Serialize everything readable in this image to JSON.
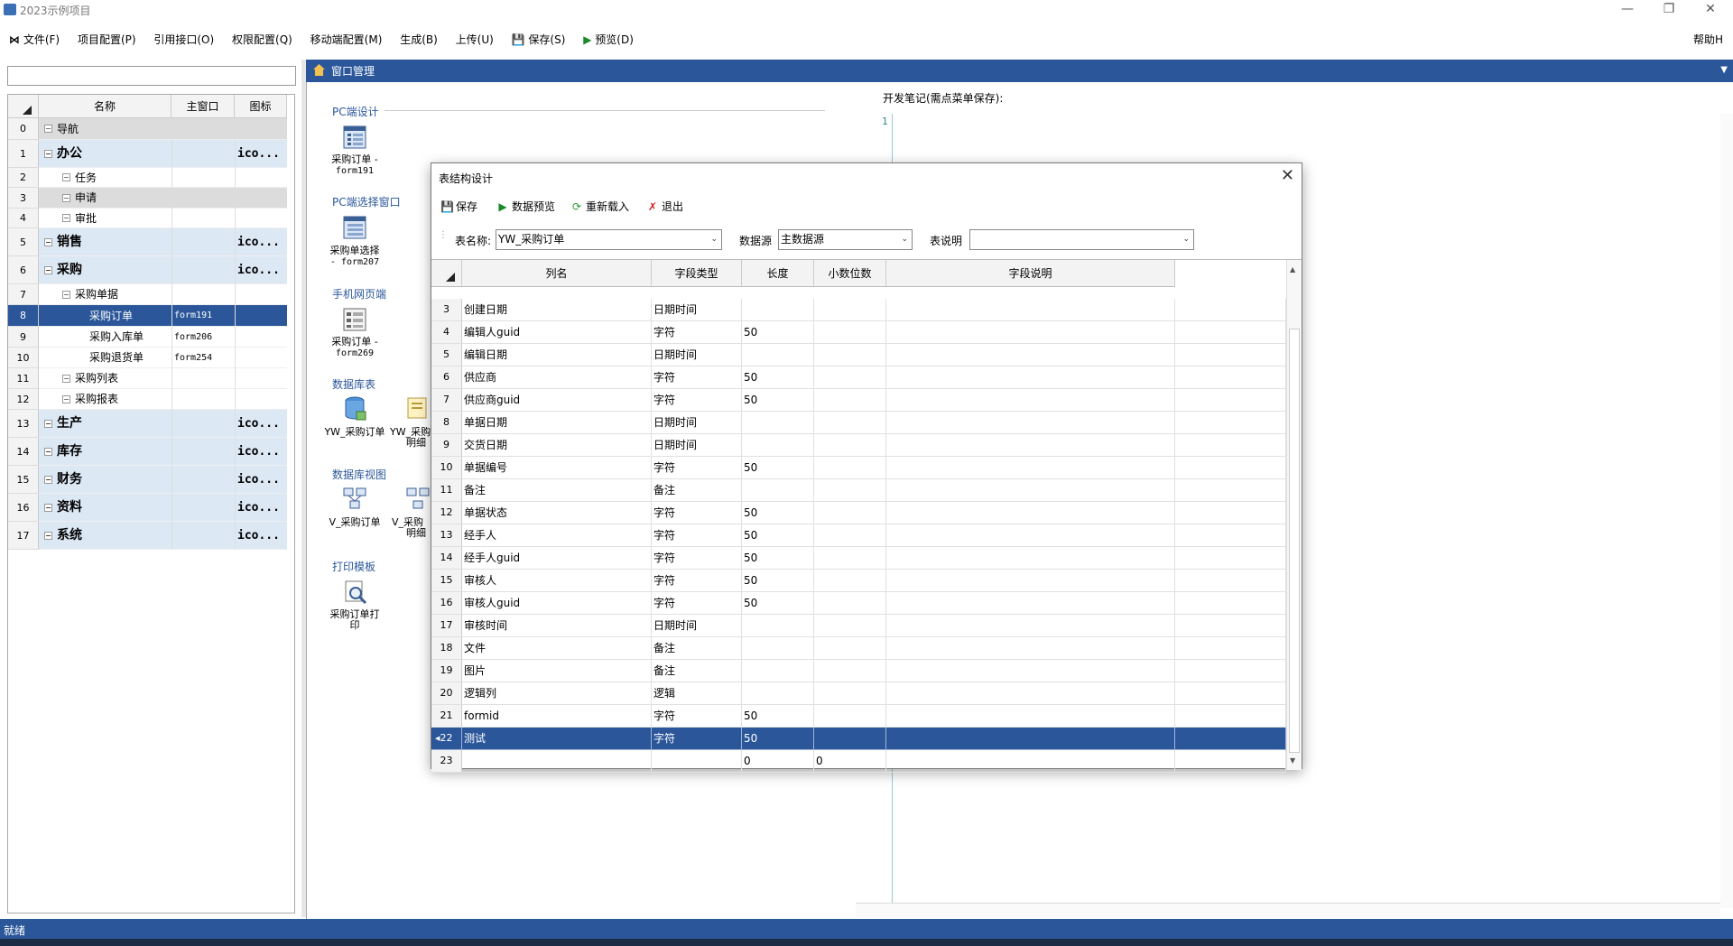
{
  "window": {
    "title": "2023示例项目"
  },
  "menu": [
    {
      "label": "文件(F)",
      "icon": "app-logo-icon"
    },
    {
      "label": "项目配置(P)"
    },
    {
      "label": "引用接口(O)"
    },
    {
      "label": "权限配置(Q)"
    },
    {
      "label": "移动端配置(M)"
    },
    {
      "label": "生成(B)"
    },
    {
      "label": "上传(U)"
    },
    {
      "label": "保存(S)",
      "icon": "floppy-icon"
    },
    {
      "label": "预览(D)",
      "icon": "play-icon"
    }
  ],
  "help": "帮助H",
  "tree": {
    "headers": [
      "名称",
      "主窗口",
      "图标"
    ],
    "rows": [
      {
        "n": "0",
        "name": "导航",
        "form": "",
        "icon": "",
        "level": 0,
        "style": "grey"
      },
      {
        "n": "1",
        "name": "办公",
        "form": "",
        "icon": "ico...",
        "level": 0,
        "style": "grp"
      },
      {
        "n": "2",
        "name": "任务",
        "form": "",
        "icon": "",
        "level": 1,
        "style": ""
      },
      {
        "n": "3",
        "name": "申请",
        "form": "",
        "icon": "",
        "level": 1,
        "style": "grey"
      },
      {
        "n": "4",
        "name": "审批",
        "form": "",
        "icon": "",
        "level": 1,
        "style": ""
      },
      {
        "n": "5",
        "name": "销售",
        "form": "",
        "icon": "ico...",
        "level": 0,
        "style": "grp"
      },
      {
        "n": "6",
        "name": "采购",
        "form": "",
        "icon": "ico...",
        "level": 0,
        "style": "grp"
      },
      {
        "n": "7",
        "name": "采购单据",
        "form": "",
        "icon": "",
        "level": 1,
        "style": ""
      },
      {
        "n": "8",
        "name": "采购订单",
        "form": "form191",
        "icon": "",
        "level": 2,
        "style": "sel"
      },
      {
        "n": "9",
        "name": "采购入库单",
        "form": "form206",
        "icon": "",
        "level": 2,
        "style": ""
      },
      {
        "n": "10",
        "name": "采购退货单",
        "form": "form254",
        "icon": "",
        "level": 2,
        "style": ""
      },
      {
        "n": "11",
        "name": "采购列表",
        "form": "",
        "icon": "",
        "level": 1,
        "style": ""
      },
      {
        "n": "12",
        "name": "采购报表",
        "form": "",
        "icon": "",
        "level": 1,
        "style": ""
      },
      {
        "n": "13",
        "name": "生产",
        "form": "",
        "icon": "ico...",
        "level": 0,
        "style": "grp"
      },
      {
        "n": "14",
        "name": "库存",
        "form": "",
        "icon": "ico...",
        "level": 0,
        "style": "grp"
      },
      {
        "n": "15",
        "name": "财务",
        "form": "",
        "icon": "ico...",
        "level": 0,
        "style": "grp"
      },
      {
        "n": "16",
        "name": "资料",
        "form": "",
        "icon": "ico...",
        "level": 0,
        "style": "grp"
      },
      {
        "n": "17",
        "name": "系统",
        "form": "",
        "icon": "ico...",
        "level": 0,
        "style": "grp"
      }
    ]
  },
  "panel": {
    "title": "窗口管理"
  },
  "sections": {
    "pc": {
      "title": "PC端设计",
      "items": [
        {
          "name": "采购订单 -",
          "sub": "form191"
        }
      ]
    },
    "pcsel": {
      "title": "PC端选择窗口",
      "items": [
        {
          "name": "采购单选择",
          "sub": "- form207"
        }
      ]
    },
    "mobile": {
      "title": "手机网页端",
      "items": [
        {
          "name": "采购订单 -",
          "sub": "form269"
        }
      ]
    },
    "db": {
      "title": "数据库表",
      "items": [
        {
          "name": "YW_采购订单",
          "sub": ""
        },
        {
          "name": "YW_采购",
          "sub": "明细"
        }
      ]
    },
    "dbview": {
      "title": "数据库视图",
      "items": [
        {
          "name": "V_采购订单",
          "sub": ""
        },
        {
          "name": "V_采购",
          "sub": "明细"
        }
      ]
    },
    "print": {
      "title": "打印模板",
      "items": [
        {
          "name": "采购订单打",
          "sub": "印"
        }
      ]
    }
  },
  "notes": {
    "label": "开发笔记(需点菜单保存):",
    "line": "1"
  },
  "status": "就绪",
  "dialog": {
    "title": "表结构设计",
    "toolbar": [
      {
        "label": "保存",
        "icon": "floppy-icon"
      },
      {
        "label": "数据预览",
        "icon": "play-icon"
      },
      {
        "label": "重新载入",
        "icon": "refresh-icon"
      },
      {
        "label": "退出",
        "icon": "close-icon"
      }
    ],
    "fields": {
      "table_label": "表名称:",
      "table_value": "YW_采购订单",
      "source_label": "数据源",
      "source_value": "主数据源",
      "desc_label": "表说明",
      "desc_value": ""
    },
    "headers": [
      "列名",
      "字段类型",
      "长度",
      "小数位数",
      "字段说明"
    ],
    "rows": [
      {
        "n": "3",
        "name": "创建日期",
        "type": "日期时间",
        "len": "",
        "dec": "",
        "desc": ""
      },
      {
        "n": "4",
        "name": "编辑人guid",
        "type": "字符",
        "len": "50",
        "dec": "",
        "desc": ""
      },
      {
        "n": "5",
        "name": "编辑日期",
        "type": "日期时间",
        "len": "",
        "dec": "",
        "desc": ""
      },
      {
        "n": "6",
        "name": "供应商",
        "type": "字符",
        "len": "50",
        "dec": "",
        "desc": ""
      },
      {
        "n": "7",
        "name": "供应商guid",
        "type": "字符",
        "len": "50",
        "dec": "",
        "desc": ""
      },
      {
        "n": "8",
        "name": "单据日期",
        "type": "日期时间",
        "len": "",
        "dec": "",
        "desc": ""
      },
      {
        "n": "9",
        "name": "交货日期",
        "type": "日期时间",
        "len": "",
        "dec": "",
        "desc": ""
      },
      {
        "n": "10",
        "name": "单据编号",
        "type": "字符",
        "len": "50",
        "dec": "",
        "desc": ""
      },
      {
        "n": "11",
        "name": "备注",
        "type": "备注",
        "len": "",
        "dec": "",
        "desc": ""
      },
      {
        "n": "12",
        "name": "单据状态",
        "type": "字符",
        "len": "50",
        "dec": "",
        "desc": ""
      },
      {
        "n": "13",
        "name": "经手人",
        "type": "字符",
        "len": "50",
        "dec": "",
        "desc": ""
      },
      {
        "n": "14",
        "name": "经手人guid",
        "type": "字符",
        "len": "50",
        "dec": "",
        "desc": ""
      },
      {
        "n": "15",
        "name": "审核人",
        "type": "字符",
        "len": "50",
        "dec": "",
        "desc": ""
      },
      {
        "n": "16",
        "name": "审核人guid",
        "type": "字符",
        "len": "50",
        "dec": "",
        "desc": ""
      },
      {
        "n": "17",
        "name": "审核时间",
        "type": "日期时间",
        "len": "",
        "dec": "",
        "desc": ""
      },
      {
        "n": "18",
        "name": "文件",
        "type": "备注",
        "len": "",
        "dec": "",
        "desc": ""
      },
      {
        "n": "19",
        "name": "图片",
        "type": "备注",
        "len": "",
        "dec": "",
        "desc": ""
      },
      {
        "n": "20",
        "name": "逻辑列",
        "type": "逻辑",
        "len": "",
        "dec": "",
        "desc": ""
      },
      {
        "n": "21",
        "name": "formid",
        "type": "字符",
        "len": "50",
        "dec": "",
        "desc": ""
      },
      {
        "n": "22",
        "name": "测试",
        "type": "字符",
        "len": "50",
        "dec": "",
        "desc": "",
        "selected": true
      },
      {
        "n": "23",
        "name": "",
        "type": "",
        "len": "0",
        "dec": "0",
        "desc": ""
      }
    ]
  },
  "colors": {
    "accent": "#2b579a",
    "group_row": "#dde8f5",
    "grey_row": "#dcdcdc"
  }
}
